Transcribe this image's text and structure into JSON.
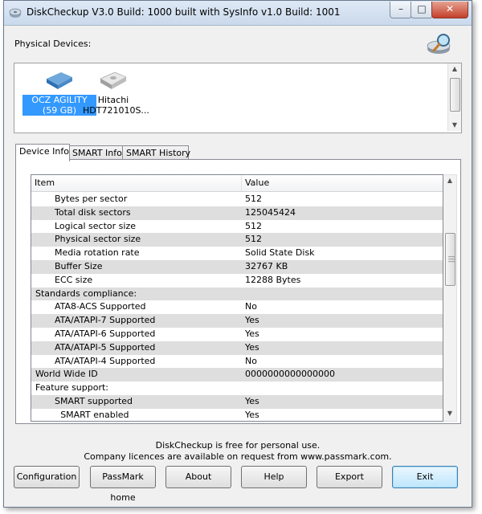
{
  "window": {
    "title": "DiskCheckup V3.0 Build: 1000 built with SysInfo v1.0 Build: 1001"
  },
  "titlebar_controls": {
    "minimize": "–",
    "maximize": "□",
    "close": "✕"
  },
  "physical_devices": {
    "label": "Physical Devices:",
    "devices": [
      {
        "name": "OCZ AGILITY (59 GB)",
        "selected": true,
        "icon": "disk-icon-blue"
      },
      {
        "name": "Hitachi HDT721010S...",
        "selected": false,
        "icon": "disk-icon-gray"
      }
    ]
  },
  "tabs": [
    {
      "label": "Device Info",
      "active": true
    },
    {
      "label": "SMART Info",
      "active": false
    },
    {
      "label": "SMART History",
      "active": false
    }
  ],
  "table": {
    "columns": [
      "Item",
      "Value"
    ],
    "rows": [
      {
        "item": "Bytes per sector",
        "value": "512",
        "indent": 1,
        "shaded": false
      },
      {
        "item": "Total disk sectors",
        "value": "125045424",
        "indent": 1,
        "shaded": true
      },
      {
        "item": "Logical sector size",
        "value": "512",
        "indent": 1,
        "shaded": false
      },
      {
        "item": "Physical sector size",
        "value": "512",
        "indent": 1,
        "shaded": true
      },
      {
        "item": "Media rotation rate",
        "value": "Solid State Disk",
        "indent": 1,
        "shaded": false
      },
      {
        "item": "Buffer Size",
        "value": "32767 KB",
        "indent": 1,
        "shaded": true
      },
      {
        "item": "ECC size",
        "value": "12288 Bytes",
        "indent": 1,
        "shaded": false
      },
      {
        "item": "Standards compliance:",
        "value": "",
        "indent": 0,
        "shaded": true
      },
      {
        "item": "ATA8-ACS Supported",
        "value": "No",
        "indent": 1,
        "shaded": false
      },
      {
        "item": "ATA/ATAPI-7 Supported",
        "value": "Yes",
        "indent": 1,
        "shaded": true
      },
      {
        "item": "ATA/ATAPI-6 Supported",
        "value": "Yes",
        "indent": 1,
        "shaded": false
      },
      {
        "item": "ATA/ATAPI-5 Supported",
        "value": "Yes",
        "indent": 1,
        "shaded": true
      },
      {
        "item": "ATA/ATAPI-4 Supported",
        "value": "No",
        "indent": 1,
        "shaded": false
      },
      {
        "item": "World Wide ID",
        "value": "0000000000000000",
        "indent": 0,
        "shaded": true
      },
      {
        "item": "Feature support:",
        "value": "",
        "indent": 0,
        "shaded": false
      },
      {
        "item": "SMART supported",
        "value": "Yes",
        "indent": 1,
        "shaded": true
      },
      {
        "item": "SMART enabled",
        "value": "Yes",
        "indent": 1.3,
        "shaded": false
      }
    ]
  },
  "footer": {
    "line1": "DiskCheckup is free for personal use.",
    "line2": "Company licences are available on request from www.passmark.com."
  },
  "buttons": {
    "configuration": "Configuration",
    "passmark_home": "PassMark home",
    "about": "About",
    "help": "Help",
    "export": "Export",
    "exit": "Exit"
  },
  "colors": {
    "selection": "#3399ff",
    "row_shade": "#dedede",
    "window_bg": "#f0f0f0"
  }
}
